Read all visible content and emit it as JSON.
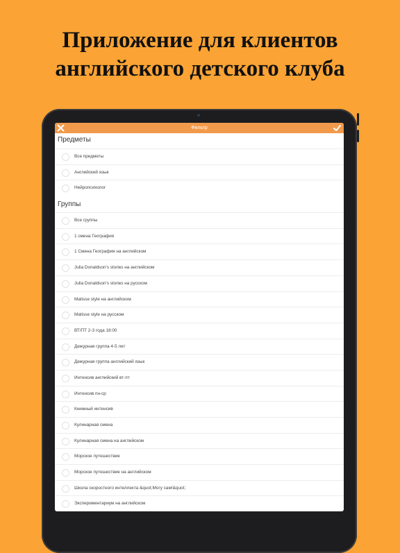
{
  "promo": {
    "line1": "Приложение для клиентов",
    "line2": "английского детского клуба"
  },
  "navbar": {
    "title": "Фильтр",
    "close_icon": "close-icon",
    "done_icon": "checkmark-icon",
    "color": "#F29A4B"
  },
  "subjects": {
    "header": "Предметы",
    "items": [
      "Все предметы",
      "Английский язык",
      "Нейропсихолог"
    ]
  },
  "groups": {
    "header": "Группы",
    "items": [
      "Все группы",
      "1 смена География",
      "1 Смена География на английском",
      "Julia Donaldson's stories на английском",
      "Julia Donaldson's stories на русском",
      "Matisse style на английском",
      "Matisse style на русском",
      "ВТ/ПТ 2-3 года 18:00",
      "Дежурная группа 4-5 лет",
      "Дежурная группа английский язык",
      "Интенсив английский вт-пт",
      "Интенсив пн-ср",
      "Книжный интенсив",
      "Кулинарная смена",
      "Кулинарная смена на английском",
      "Морское путешествие",
      "Морское путешествие на английском",
      "Школа скоростного интеллекта &quot;Могу сам!&quot;",
      "Экспериментариум на английском"
    ]
  },
  "colors": {
    "background": "#FBA334",
    "navbar": "#F29A4B"
  }
}
